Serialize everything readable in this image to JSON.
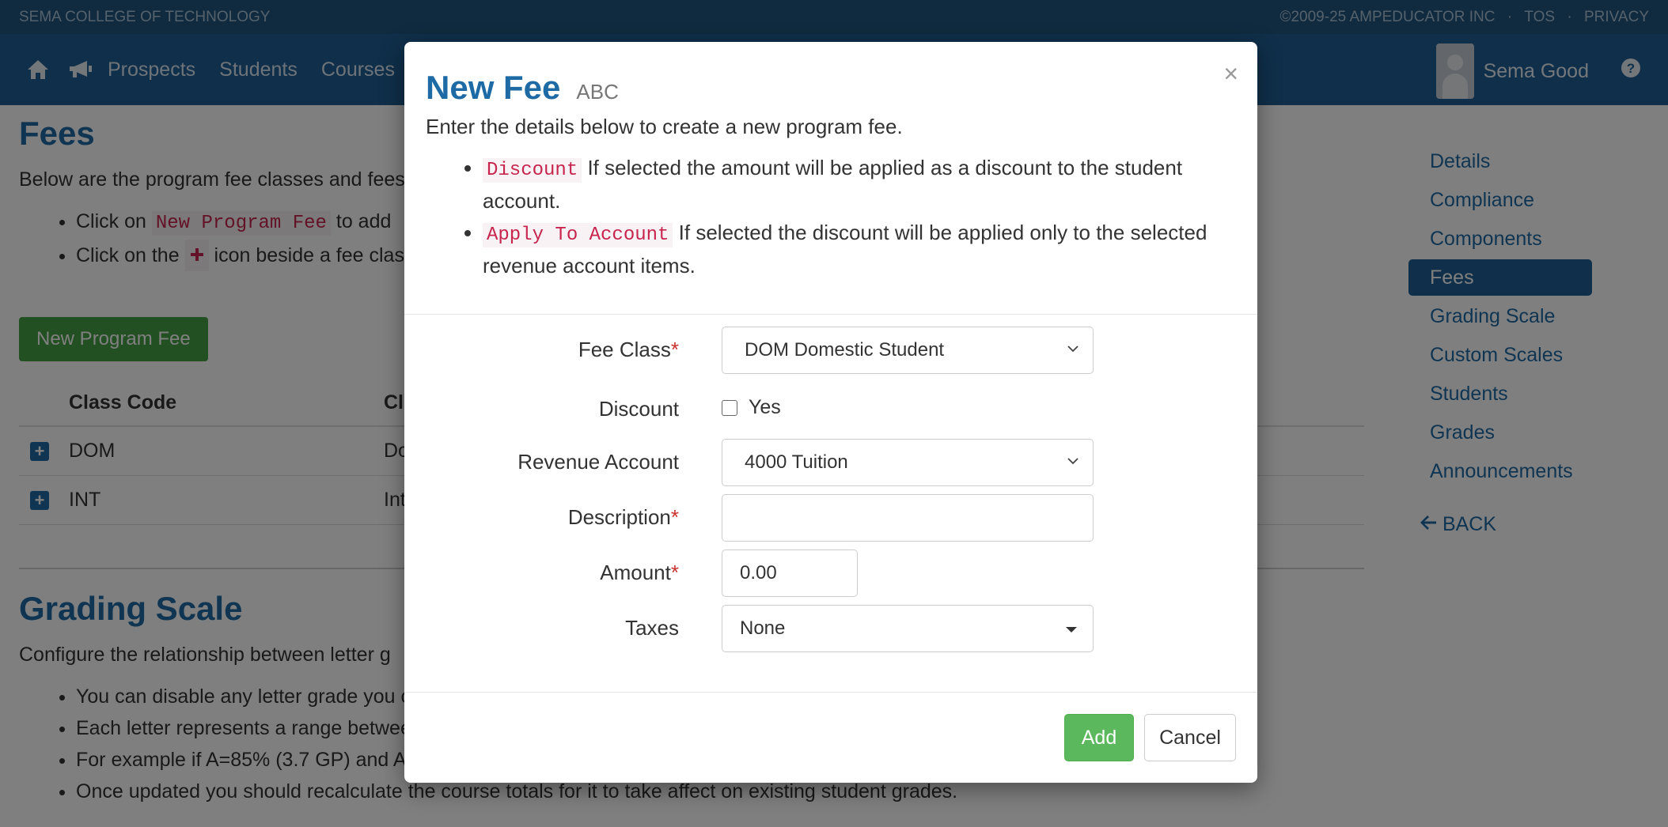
{
  "topbar": {
    "college": "SEMA COLLEGE OF TECHNOLOGY",
    "copyright": "©2009-25 AMPEDUCATOR INC",
    "sep": "·",
    "tos": "TOS",
    "privacy": "PRIVACY"
  },
  "nav": {
    "items": [
      "Prospects",
      "Students",
      "Courses"
    ],
    "user": "Sema Good"
  },
  "page": {
    "fees_title": "Fees",
    "fees_lead": "Below are the program fee classes and fees",
    "fees_bullets": [
      {
        "pre": "Click on",
        "code": "New Program Fee",
        "post": "to add"
      },
      {
        "pre": "Click on the",
        "post": "icon beside a fee clas"
      }
    ],
    "new_fee_button": "New Program Fee",
    "table": {
      "headers": [
        "Class Code",
        "Cl"
      ],
      "rows": [
        {
          "code": "DOM",
          "name": "Do"
        },
        {
          "code": "INT",
          "name": "Int"
        }
      ]
    },
    "grading_title": "Grading Scale",
    "grading_lead": "Configure the relationship between letter g",
    "grading_bullets": [
      "You can disable any letter grade you c",
      "Each letter represents a range betwee",
      "For example if A=85% (3.7 GP) and A+",
      "Once updated you should recalculate the course totals for it to take affect on existing student grades."
    ]
  },
  "sidenav": {
    "items": [
      "Details",
      "Compliance",
      "Components",
      "Fees",
      "Grading Scale",
      "Custom Scales",
      "Students",
      "Grades",
      "Announcements"
    ],
    "back": "BACK"
  },
  "modal": {
    "title": "New Fee",
    "subtitle": "ABC",
    "close": "×",
    "description": "Enter the details below to create a new program fee.",
    "notes": [
      {
        "code": "Discount",
        "text": "If selected the amount will be applied as a discount to the student account."
      },
      {
        "code": "Apply To Account",
        "text": "If selected the discount will be applied only to the selected revenue account items."
      }
    ],
    "form": {
      "fee_class_label": "Fee Class",
      "fee_class_value": "DOM Domestic Student",
      "discount_label": "Discount",
      "discount_option": "Yes",
      "revenue_label": "Revenue Account",
      "revenue_value": "4000 Tuition",
      "description_label": "Description",
      "description_value": "",
      "amount_label": "Amount",
      "amount_value": "0.00",
      "taxes_label": "Taxes",
      "taxes_value": "None",
      "required_mark": "*"
    },
    "add_label": "Add",
    "cancel_label": "Cancel"
  }
}
